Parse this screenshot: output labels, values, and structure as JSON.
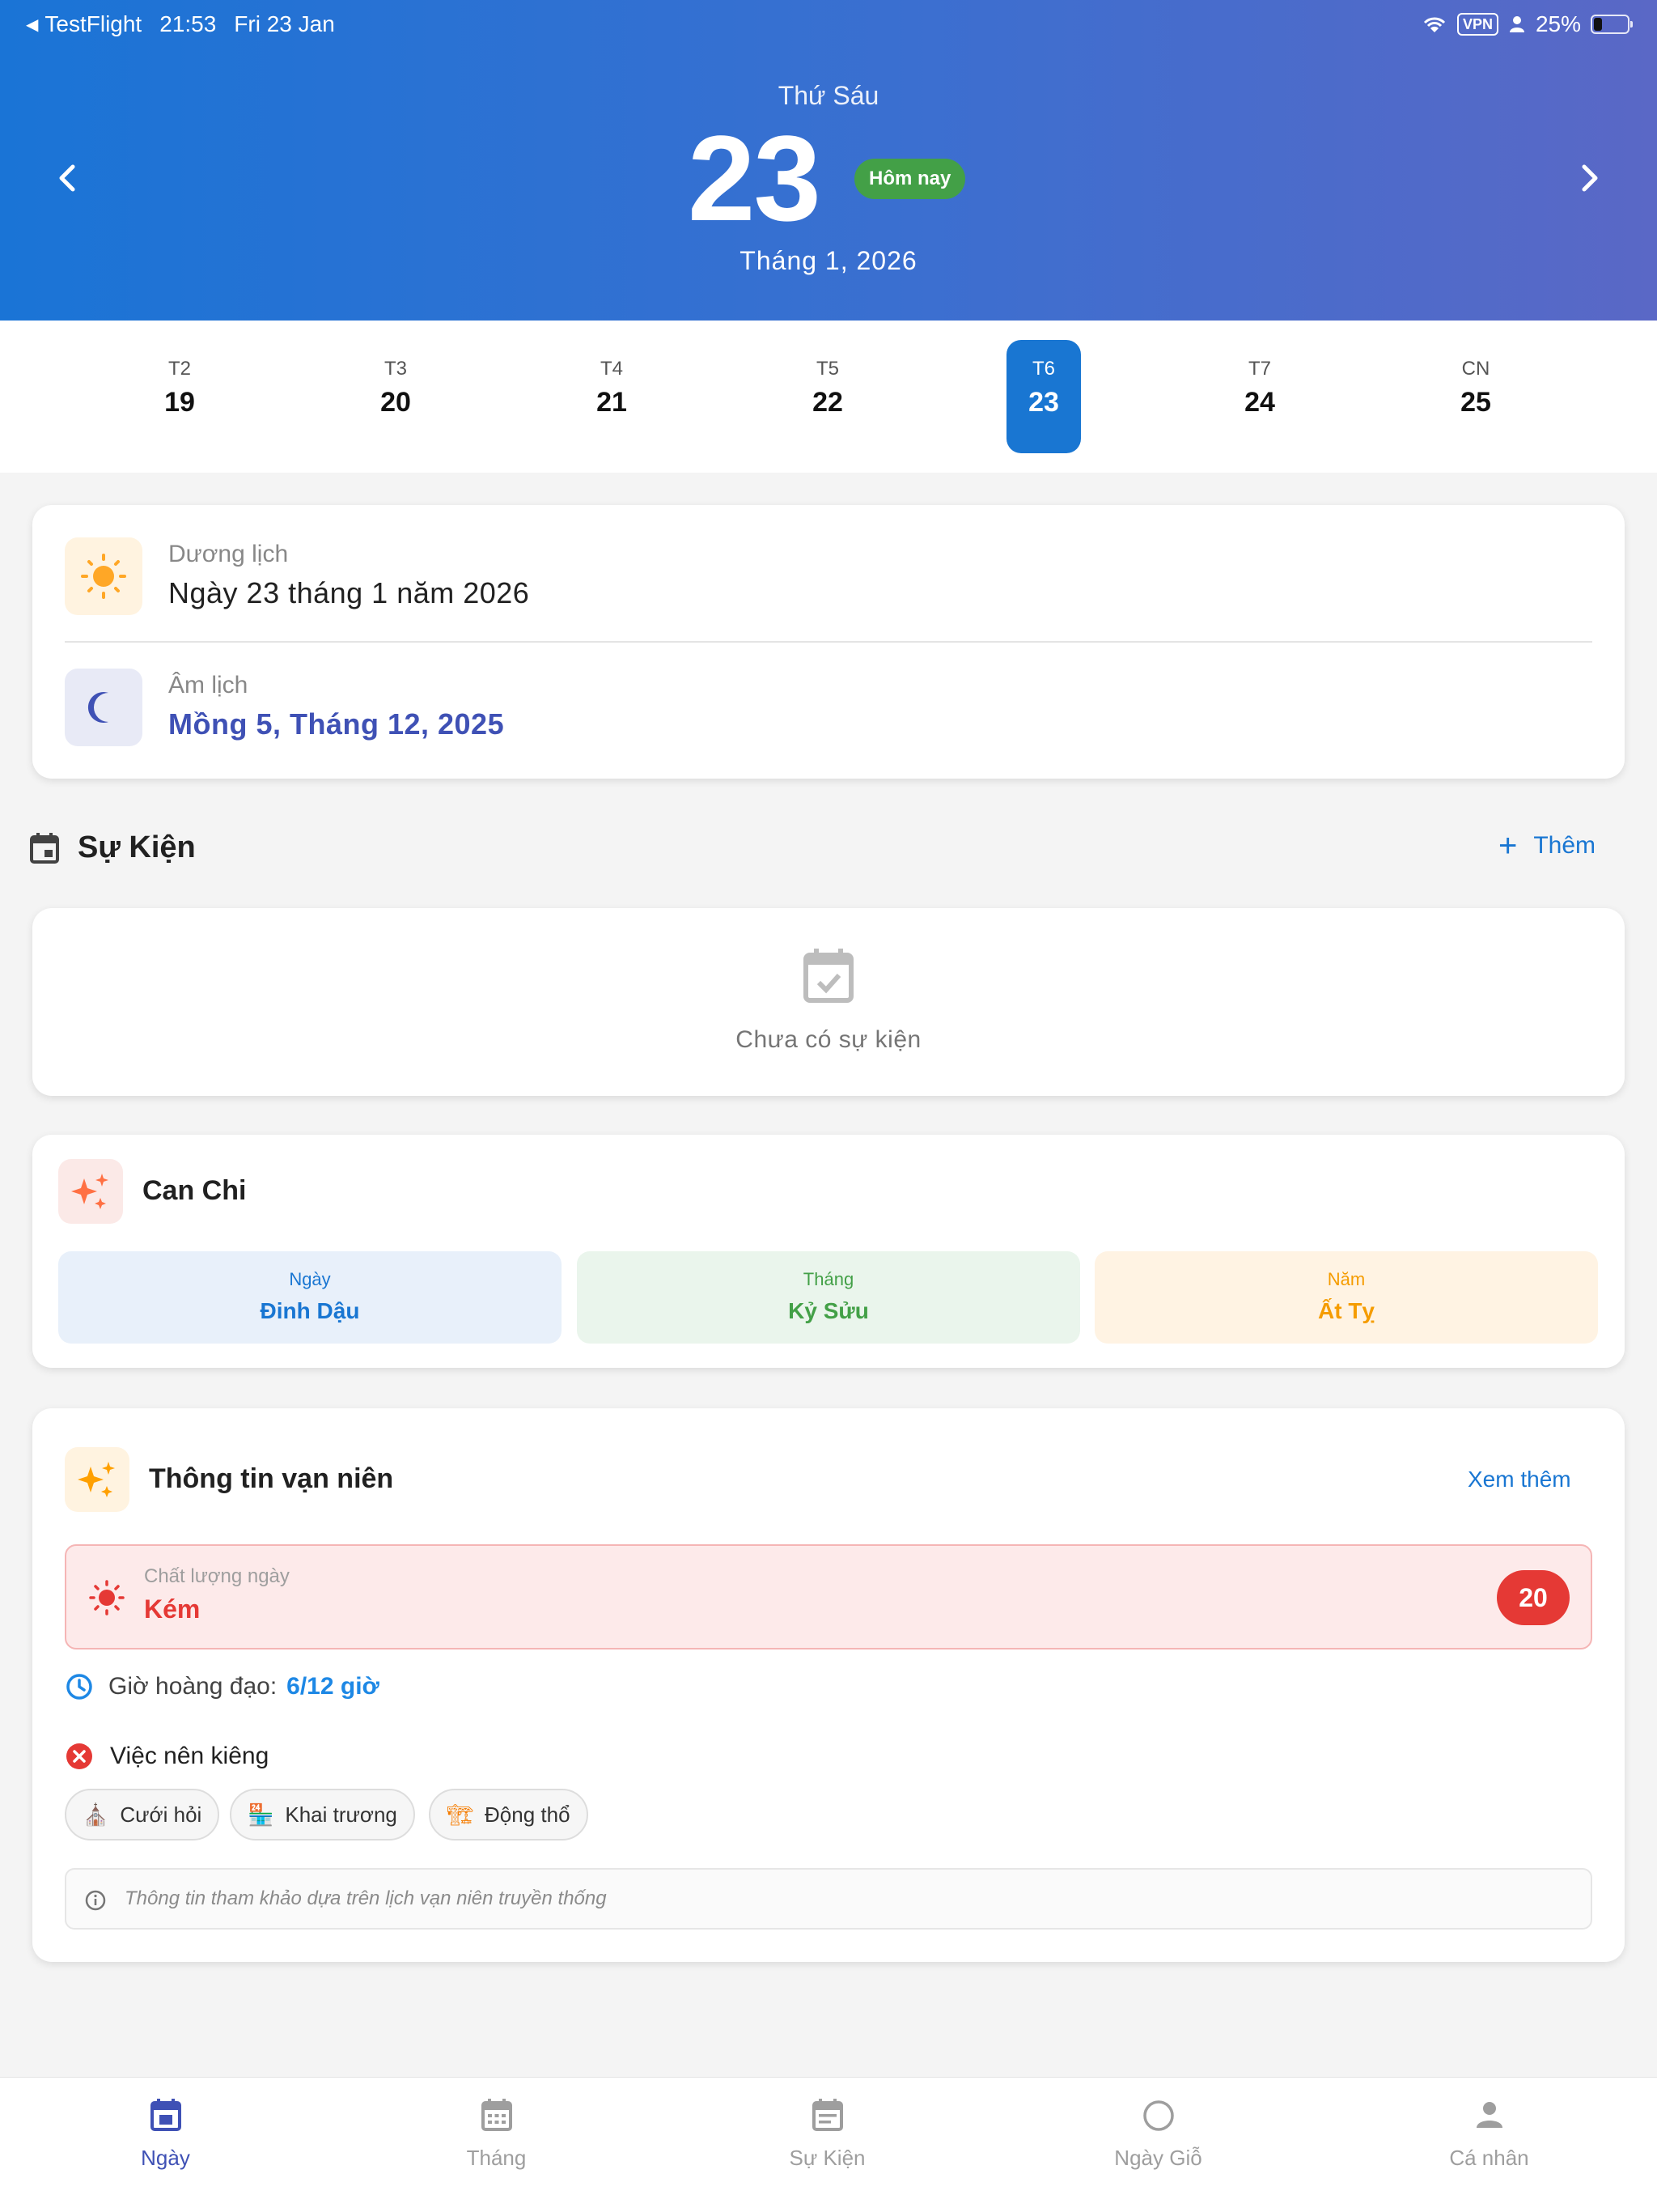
{
  "status_bar": {
    "back_app": "TestFlight",
    "time": "21:53",
    "date": "Fri 23 Jan",
    "vpn": "VPN",
    "battery": "25%",
    "battery_level": 0.25
  },
  "header": {
    "weekday": "Thứ Sáu",
    "day": "23",
    "today_badge": "Hôm nay",
    "month_year": "Tháng 1, 2026"
  },
  "week": [
    {
      "label": "T2",
      "day": "19"
    },
    {
      "label": "T3",
      "day": "20"
    },
    {
      "label": "T4",
      "day": "21"
    },
    {
      "label": "T5",
      "day": "22"
    },
    {
      "label": "T6",
      "day": "23",
      "selected": true
    },
    {
      "label": "T7",
      "day": "24"
    },
    {
      "label": "CN",
      "day": "25"
    }
  ],
  "date_card": {
    "solar_label": "Dương lịch",
    "solar_value": "Ngày 23 tháng 1 năm 2026",
    "lunar_label": "Âm lịch",
    "lunar_value": "Mồng 5, Tháng 12, 2025"
  },
  "events": {
    "title": "Sự Kiện",
    "add_label": "Thêm",
    "empty_text": "Chưa có sự kiện"
  },
  "can_chi": {
    "title": "Can Chi",
    "day_label": "Ngày",
    "day_value": "Đinh Dậu",
    "month_label": "Tháng",
    "month_value": "Kỷ Sửu",
    "year_label": "Năm",
    "year_value": "Ất Tỵ"
  },
  "almanac": {
    "title": "Thông tin vạn niên",
    "see_more": "Xem thêm",
    "quality_label": "Chất lượng ngày",
    "quality_value": "Kém",
    "quality_score": "20",
    "good_hours_label": "Giờ hoàng đạo:",
    "good_hours_value": "6/12 giờ",
    "avoid_title": "Việc nên kiêng",
    "avoid_items": [
      "Cưới hỏi",
      "Khai trương",
      "Động thổ"
    ],
    "note": "Thông tin tham khảo dựa trên lịch vạn niên truyền thống"
  },
  "bottom_nav": [
    {
      "label": "Ngày",
      "active": true
    },
    {
      "label": "Tháng"
    },
    {
      "label": "Sự Kiện"
    },
    {
      "label": "Ngày Giỗ"
    },
    {
      "label": "Cá nhân"
    }
  ],
  "colors": {
    "primary": "#1976d2",
    "today_badge": "#43a047",
    "lunar_text": "#3f51b5",
    "bad_quality": "#e53935"
  }
}
